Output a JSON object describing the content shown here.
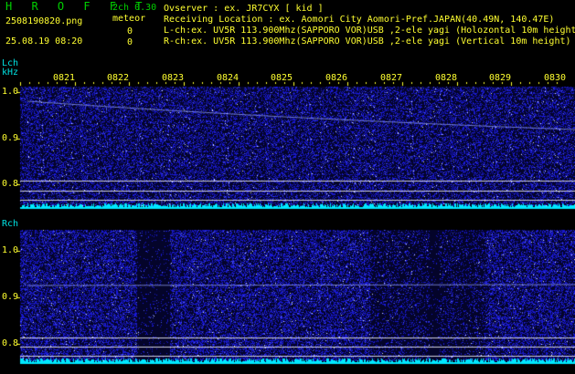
{
  "header": {
    "app_name": "H R O F F T",
    "channel_info": "2ch 0.30",
    "filename": "2508190820.png",
    "detect_label": "meteor",
    "datetime": "25.08.19 08:20",
    "l_count": "0",
    "r_count": "0",
    "observer": "Ovserver                : ex. JR7CYX [ kid ]",
    "location": "Receiving Location : ex. Aomori City Aomori-Pref.JAPAN(40.49N, 140.47E)",
    "l_channel": "L-ch:ex. UV5R 113.900Mhz(SAPPORO VOR)USB ,2-ele yagi (Holozontal 10m height)",
    "r_channel": "R-ch:ex. UV5R 113.900Mhz(SAPPORO VOR)USB ,2-ele yagi (Vertical 10m height)"
  },
  "lch": {
    "label": "Lch",
    "unit": "kHz",
    "ticks": [
      "1.0",
      "0.9",
      "0.8"
    ]
  },
  "rch": {
    "label": "Rch",
    "ticks": [
      "1.0",
      "0.9",
      "0.8"
    ]
  },
  "time_labels": [
    "0821",
    "0822",
    "0823",
    "0824",
    "0825",
    "0826",
    "0827",
    "0828",
    "0829",
    "0830"
  ],
  "colors": {
    "background": "#000000",
    "header_green": "#00d000",
    "header_yellow": "#ffff30",
    "time_label": "#ffff30",
    "axis_label": "#00e0e0",
    "spectrum_noise": "#1a1acc",
    "signal_line": "#9aa8ff",
    "baseline": "#00e8ff"
  }
}
